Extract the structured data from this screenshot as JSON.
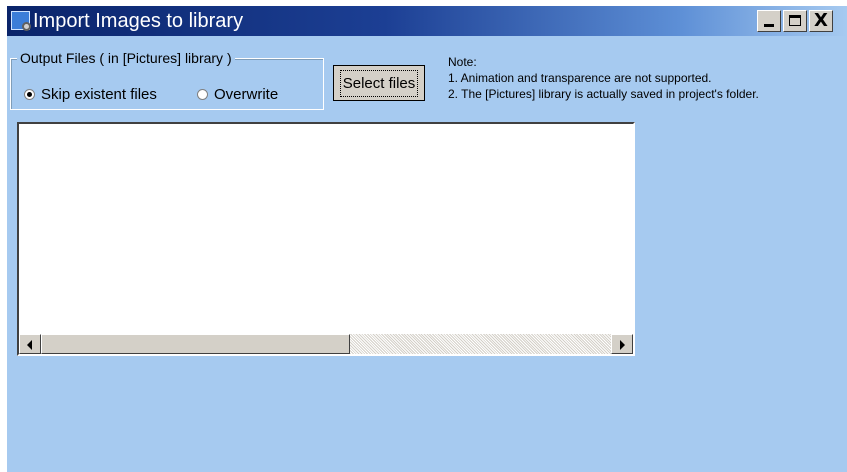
{
  "window": {
    "title": "Import Images to library",
    "controls": {
      "minimize_icon": "minimize-icon",
      "maximize_icon": "maximize-icon",
      "close_label": "X"
    },
    "background": "#a6caf0",
    "titlebar_color": "#0a246a"
  },
  "output_files": {
    "legend": "Output Files ( in [Pictures] library )",
    "options": [
      {
        "label": "Skip existent files",
        "checked": true
      },
      {
        "label": "Overwrite",
        "checked": false
      }
    ]
  },
  "select_button": {
    "label": "Select files"
  },
  "note": {
    "heading": "Note:",
    "lines": [
      "1. Animation and transparence are not supported.",
      "2. The [Pictures] library is actually saved in project's folder."
    ]
  },
  "file_list": {
    "items": [],
    "scrollbar": {
      "left_icon": "arrow-left-icon",
      "right_icon": "arrow-right-icon",
      "position": 0
    }
  }
}
